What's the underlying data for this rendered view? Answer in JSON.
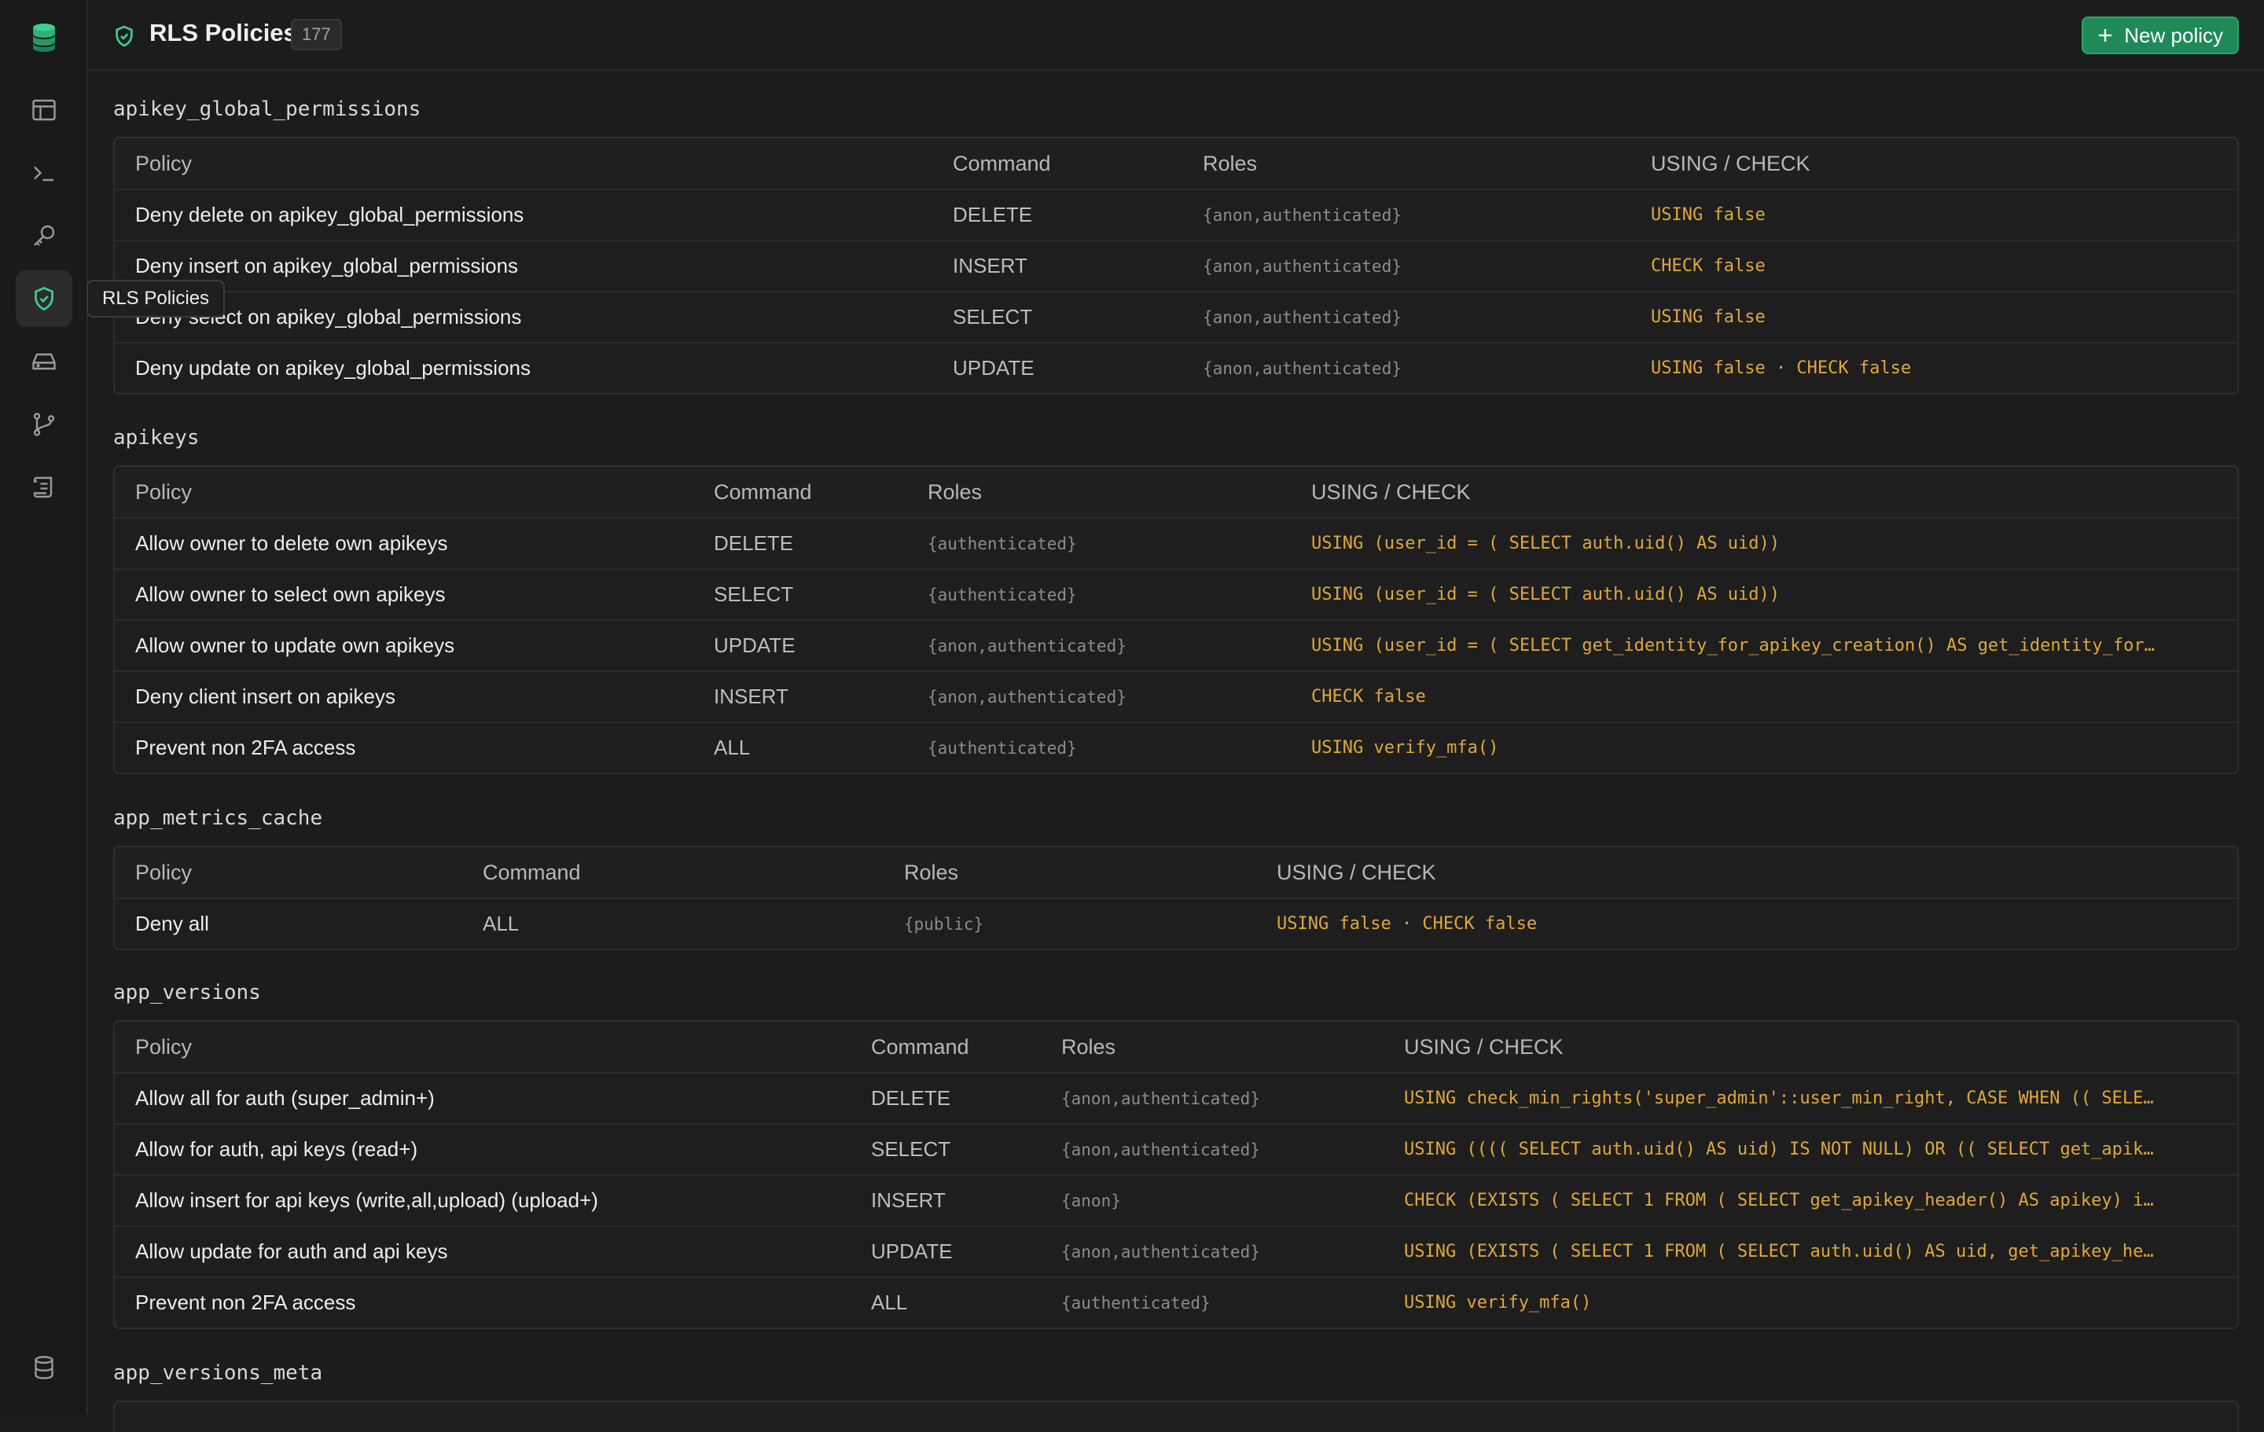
{
  "header": {
    "title": "RLS Policies",
    "count": "177",
    "new_button": "New policy"
  },
  "tooltip": "RLS Policies",
  "sidebar": {
    "items": [
      {
        "icon": "table-editor-icon"
      },
      {
        "icon": "terminal-icon"
      },
      {
        "icon": "key-icon"
      },
      {
        "icon": "shield-check-icon",
        "active": true
      },
      {
        "icon": "storage-icon"
      },
      {
        "icon": "git-branch-icon"
      },
      {
        "icon": "logs-icon"
      }
    ],
    "bottom": {
      "icon": "database-icon"
    }
  },
  "columns": {
    "policy": "Policy",
    "command": "Command",
    "roles": "Roles",
    "using": "USING / CHECK"
  },
  "sections": [
    {
      "name": "apikey_global_permissions",
      "rows": [
        {
          "policy": "Deny delete on apikey_global_permissions",
          "command": "DELETE",
          "roles": "{anon,authenticated}",
          "using": "USING false"
        },
        {
          "policy": "Deny insert on apikey_global_permissions",
          "command": "INSERT",
          "roles": "{anon,authenticated}",
          "using": "CHECK false"
        },
        {
          "policy": "Deny select on apikey_global_permissions",
          "command": "SELECT",
          "roles": "{anon,authenticated}",
          "using": "USING false"
        },
        {
          "policy": "Deny update on apikey_global_permissions",
          "command": "UPDATE",
          "roles": "{anon,authenticated}",
          "using": "USING false · CHECK false"
        }
      ]
    },
    {
      "name": "apikeys",
      "rows": [
        {
          "policy": "Allow owner to delete own apikeys",
          "command": "DELETE",
          "roles": "{authenticated}",
          "using": "USING (user_id = ( SELECT auth.uid() AS uid))"
        },
        {
          "policy": "Allow owner to select own apikeys",
          "command": "SELECT",
          "roles": "{authenticated}",
          "using": "USING (user_id = ( SELECT auth.uid() AS uid))"
        },
        {
          "policy": "Allow owner to update own apikeys",
          "command": "UPDATE",
          "roles": "{anon,authenticated}",
          "using": "USING (user_id = ( SELECT get_identity_for_apikey_creation() AS get_identity_for…"
        },
        {
          "policy": "Deny client insert on apikeys",
          "command": "INSERT",
          "roles": "{anon,authenticated}",
          "using": "CHECK false"
        },
        {
          "policy": "Prevent non 2FA access",
          "command": "ALL",
          "roles": "{authenticated}",
          "using": "USING verify_mfa()"
        }
      ]
    },
    {
      "name": "app_metrics_cache",
      "rows": [
        {
          "policy": "Deny all",
          "command": "ALL",
          "roles": "{public}",
          "using": "USING false · CHECK false"
        }
      ]
    },
    {
      "name": "app_versions",
      "rows": [
        {
          "policy": "Allow all for auth (super_admin+)",
          "command": "DELETE",
          "roles": "{anon,authenticated}",
          "using": "USING check_min_rights('super_admin'::user_min_right, CASE WHEN (( SELE…"
        },
        {
          "policy": "Allow for auth, api keys (read+)",
          "command": "SELECT",
          "roles": "{anon,authenticated}",
          "using": "USING (((( SELECT auth.uid() AS uid) IS NOT NULL) OR (( SELECT get_apik…"
        },
        {
          "policy": "Allow insert for api keys (write,all,upload) (upload+)",
          "command": "INSERT",
          "roles": "{anon}",
          "using": "CHECK (EXISTS ( SELECT 1 FROM ( SELECT get_apikey_header() AS apikey) i…"
        },
        {
          "policy": "Allow update for auth and api keys",
          "command": "UPDATE",
          "roles": "{anon,authenticated}",
          "using": "USING (EXISTS ( SELECT 1 FROM ( SELECT auth.uid() AS uid, get_apikey_he…"
        },
        {
          "policy": "Prevent non 2FA access",
          "command": "ALL",
          "roles": "{authenticated}",
          "using": "USING verify_mfa()"
        }
      ]
    },
    {
      "name": "app_versions_meta",
      "rows": []
    }
  ],
  "colors": {
    "accent": "#3ecf8e",
    "button": "#1f8a57",
    "using_text": "#e0a83a"
  }
}
